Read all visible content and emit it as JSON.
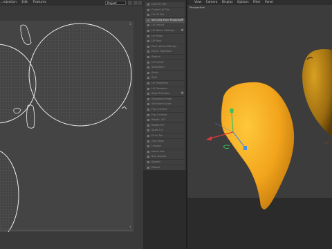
{
  "uv_editor": {
    "menu": [
      "...rojection",
      "Edit",
      "Features"
    ],
    "dropdown_value": "Project",
    "corner_label": "1"
  },
  "tools": {
    "items": [
      {
        "label": "Unit UV Tile"
      },
      {
        "label": "Center UV Tile"
      },
      {
        "label": "Fill UV Tile"
      },
      {
        "label": "Set UVW From Projection",
        "active": true
      },
      {
        "label": "UV Unfold"
      },
      {
        "label": "UV Match Settings"
      },
      {
        "label": "UV Relax"
      },
      {
        "label": "UV Pack"
      },
      {
        "label": "Pack Island Settings"
      },
      {
        "label": "Mirror Projection"
      },
      {
        "label": "Stretch"
      },
      {
        "label": "UV Orient"
      },
      {
        "label": "Straighten"
      },
      {
        "label": "Stitch"
      },
      {
        "label": "Split"
      },
      {
        "label": "UV Projection"
      },
      {
        "label": "UV Gaussian"
      },
      {
        "label": "Align Selection"
      },
      {
        "label": "Straighten Edge"
      },
      {
        "label": "Set Island Scale"
      },
      {
        "label": "Flip U Orient"
      },
      {
        "label": "Flip V Orient"
      },
      {
        "label": "Rotate -90°"
      },
      {
        "label": "Rotate 90°"
      },
      {
        "label": "Scale 1.0"
      },
      {
        "label": "Fit to Tile"
      },
      {
        "label": "Grid Snap"
      },
      {
        "label": "Unwrap"
      },
      {
        "label": "Island Info"
      },
      {
        "label": "Sew Islands"
      },
      {
        "label": "Spread"
      },
      {
        "label": "Distort"
      }
    ]
  },
  "viewport": {
    "menu": [
      "View",
      "Camera",
      "Display",
      "Options",
      "Filter",
      "Panel"
    ],
    "label": "Perspective"
  },
  "colors": {
    "mango": "#f2a41c",
    "accent_red": "#e03a3a",
    "accent_green": "#3ac05a",
    "accent_blue": "#4a8ee0"
  }
}
